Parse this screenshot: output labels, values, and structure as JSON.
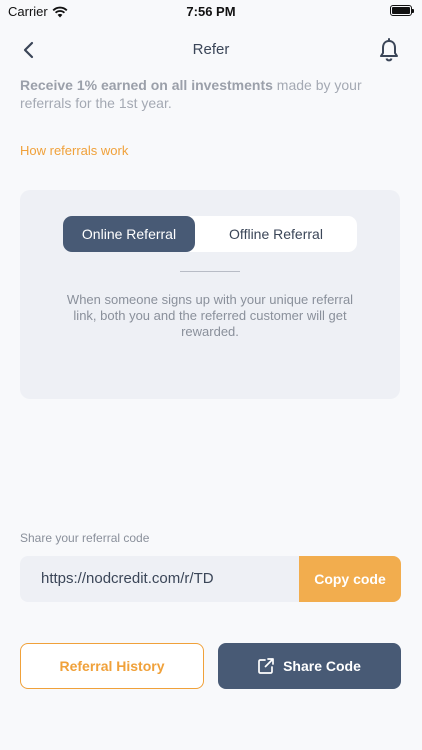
{
  "status_bar": {
    "carrier": "Carrier",
    "time": "7:56 PM"
  },
  "nav": {
    "title": "Refer"
  },
  "intro": {
    "bold": "Receive 1% earned on all investments",
    "rest": " made by your referrals for the 1st year."
  },
  "how_link": "How referrals work",
  "referral_card": {
    "tabs": [
      {
        "label": "Online Referral",
        "active": true
      },
      {
        "label": "Offline Referral",
        "active": false
      }
    ],
    "description": "When someone signs up with your unique referral link, both you and the referred customer will get rewarded."
  },
  "share": {
    "label": "Share your referral code",
    "code": "https://nodcredit.com/r/TD",
    "copy_label": "Copy code"
  },
  "actions": {
    "history_label": "Referral History",
    "share_code_label": "Share Code"
  },
  "colors": {
    "accent": "#f0a13a",
    "primary": "#485a75",
    "background": "#f8f9fb",
    "card": "#eef0f5"
  },
  "icons": [
    "wifi-icon",
    "battery-icon",
    "back-chevron-icon",
    "bell-icon",
    "share-external-icon"
  ]
}
